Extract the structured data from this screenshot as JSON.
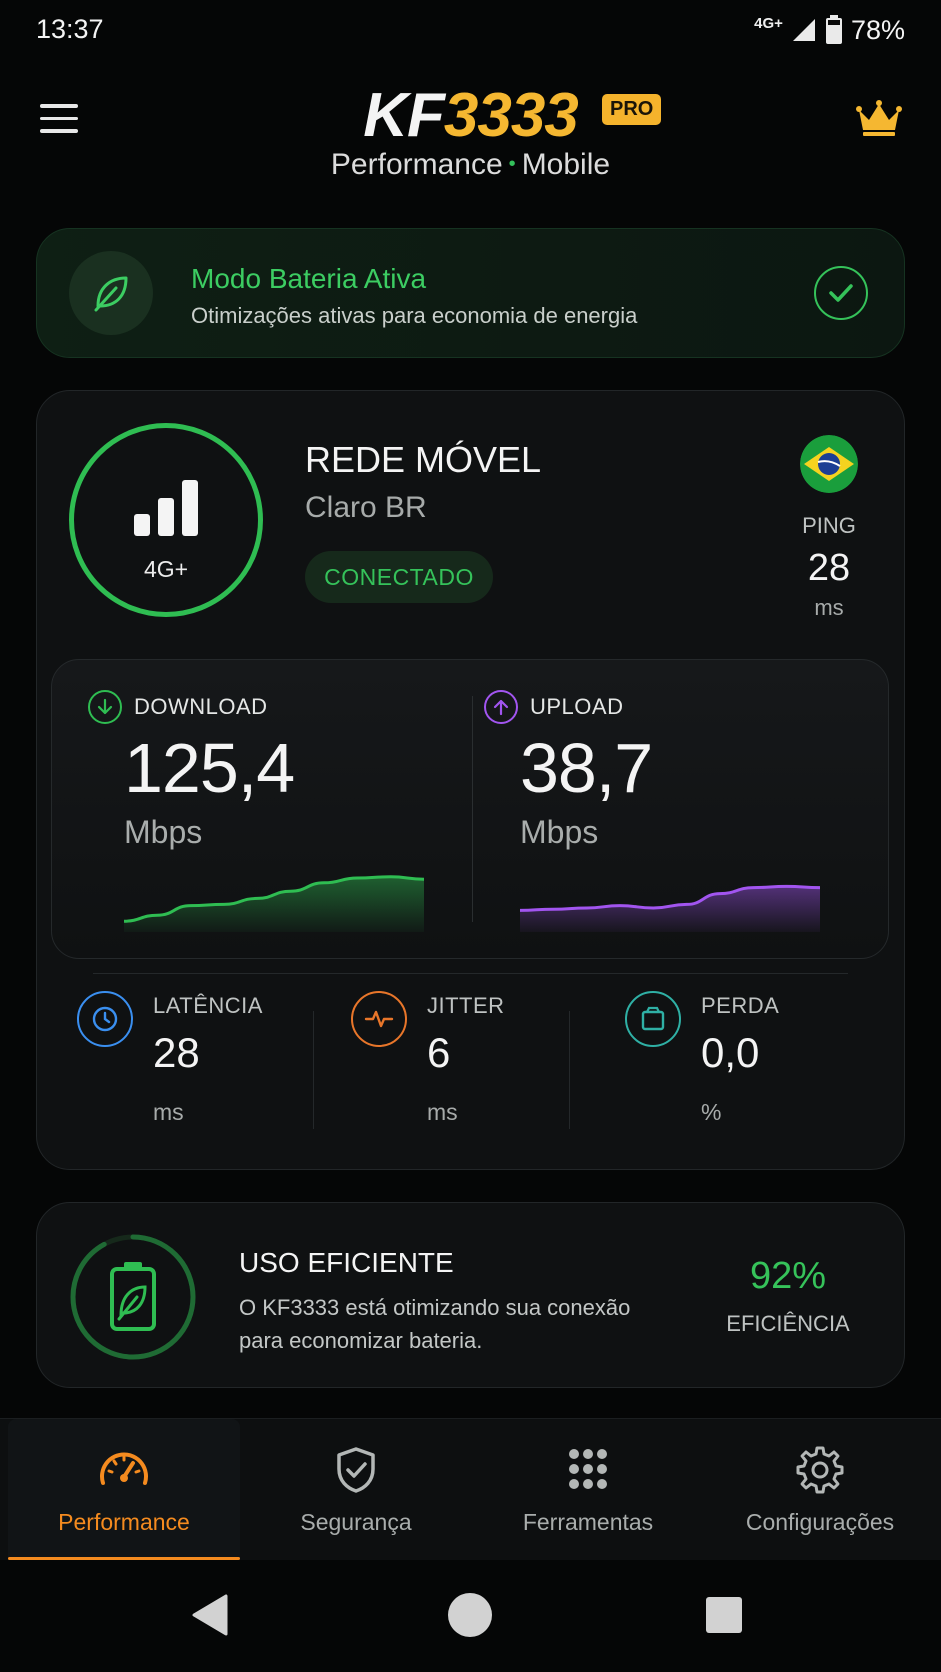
{
  "status_bar": {
    "time": "13:37",
    "network_type": "4G+",
    "battery_percent": "78%"
  },
  "header": {
    "logo_prefix": "KF",
    "logo_number": "3333",
    "badge": "PRO",
    "subtitle_left": "Performance",
    "subtitle_separator": "•",
    "subtitle_right": "Mobile"
  },
  "battery_mode": {
    "title": "Modo Bateria Ativa",
    "subtitle": "Otimizações ativas para economia de energia",
    "active": true
  },
  "network": {
    "type_label": "4G+",
    "title": "REDE MÓVEL",
    "carrier": "Claro BR",
    "status": "CONECTADO",
    "ping_label": "PING",
    "ping_value": "28",
    "ping_unit": "ms"
  },
  "speed": {
    "download": {
      "label": "DOWNLOAD",
      "value": "125,4",
      "unit": "Mbps",
      "color": "#2fbd52",
      "trend": [
        8,
        18,
        34,
        36,
        46,
        58,
        72,
        80,
        82,
        78
      ]
    },
    "upload": {
      "label": "UPLOAD",
      "value": "38,7",
      "unit": "Mbps",
      "color": "#a255f0",
      "trend": [
        26,
        28,
        30,
        34,
        30,
        36,
        54,
        64,
        66,
        64
      ]
    }
  },
  "stats": [
    {
      "label": "LATÊNCIA",
      "value": "28",
      "unit": "ms",
      "icon": "clock-icon",
      "color": "#3a8ff0"
    },
    {
      "label": "JITTER",
      "value": "6",
      "unit": "ms",
      "icon": "pulse-icon",
      "color": "#e8762a"
    },
    {
      "label": "PERDA",
      "value": "0,0",
      "unit": "%",
      "icon": "box-icon",
      "color": "#2fb0a5"
    }
  ],
  "efficiency": {
    "title": "USO EFICIENTE",
    "description": "O KF3333 está otimizando sua conexão para economizar bateria.",
    "percent": "92%",
    "percent_value": 0.92,
    "label": "EFICIÊNCIA"
  },
  "bottom_nav": {
    "items": [
      {
        "label": "Performance",
        "icon": "speedometer-icon",
        "active": true
      },
      {
        "label": "Segurança",
        "icon": "shield-check-icon",
        "active": false
      },
      {
        "label": "Ferramentas",
        "icon": "grid-dots-icon",
        "active": false
      },
      {
        "label": "Configurações",
        "icon": "gear-icon",
        "active": false
      }
    ]
  },
  "colors": {
    "accent_orange": "#f58b1f",
    "accent_gold": "#f5b731",
    "accent_green": "#35c25a",
    "accent_purple": "#a255f0"
  }
}
